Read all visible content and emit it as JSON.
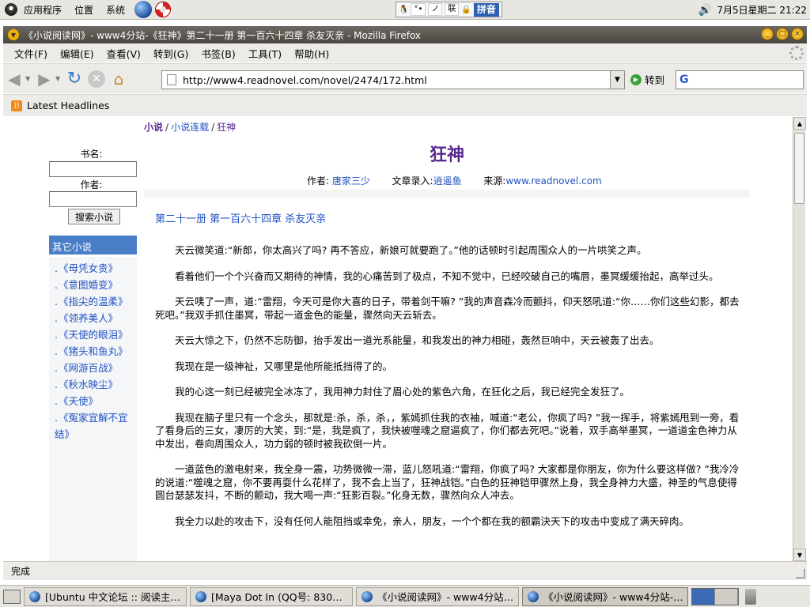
{
  "top_panel": {
    "applications": "应用程序",
    "places": "位置",
    "system": "系统",
    "ime_label": "拼音",
    "ime_seg1": "°•",
    "ime_seg2": "ノ",
    "ime_seg3": "联",
    "datetime": "7月5日星期二 21:22"
  },
  "window": {
    "title": "《小说阅读网》- www4分站-《狂神》第二十一册 第一百六十四章 杀友灭亲 - Mozilla Firefox"
  },
  "menubar": [
    "文件(F)",
    "编辑(E)",
    "查看(V)",
    "转到(G)",
    "书签(B)",
    "工具(T)",
    "帮助(H)"
  ],
  "navbar": {
    "url": "http://www4.readnovel.com/novel/2474/172.html",
    "go_label": "转到",
    "search_placeholder": ""
  },
  "bookmarks": {
    "latest_headlines": "Latest Headlines"
  },
  "breadcrumb": {
    "item1": "小说",
    "item2": "小说连载",
    "item3": "狂神"
  },
  "sidebar": {
    "book_name_label": "书名:",
    "author_label": "作者:",
    "search_button": "搜索小说",
    "other_header": "其它小说",
    "other_items": [
      "《母凭女贵》",
      "《意图婚变》",
      "《指尖的温柔》",
      "《领养美人》",
      "《天使的眼泪》",
      "《猪头和鱼丸》",
      "《网游百战》",
      "《秋水映尘》",
      "《天使》",
      "《冤家宜解不宜结》"
    ]
  },
  "main": {
    "novel_title": "狂神",
    "author_label": "作者:",
    "author": "唐家三少",
    "entry_label": "文章录入:",
    "entry_by": "逍遥鱼",
    "source_label": "来源:",
    "source": "www.readnovel.com",
    "chapter_title": "第二十一册 第一百六十四章 杀友灭亲",
    "paragraphs": [
      "天云微笑道:“新郎，你太高兴了吗? 再不答应，新娘可就要跑了。”他的话顿时引起周围众人的一片哄笑之声。",
      "看着他们一个个兴奋而又期待的神情，我的心痛苦到了极点，不知不觉中，已经咬破自己的嘴唇，墨冥缓缓抬起，高举过头。",
      "天云咦了一声，道:“雷翔，今天可是你大喜的日子，带着剑干嘛? ”我的声音森冷而颤抖，仰天怒吼道:“你……你们这些幻影，都去死吧。”我双手抓住墨冥，带起一道金色的能量，骤然向天云斩去。",
      "天云大惊之下，仍然不忘防御，抬手发出一道光系能量，和我发出的神力相碰，轰然巨响中，天云被轰了出去。",
      "我现在是一级神祉，又哪里是他所能抵挡得了的。",
      "我的心这一刻已经被完全冰冻了，我用神力封住了眉心处的紫色六角，在狂化之后，我已经完全发狂了。",
      "我现在脑子里只有一个念头，那就是:杀，杀，杀，，紫嫣抓住我的衣袖，喊道:“老公，你疯了吗? ”我一挥手，将紫嫣甩到一旁，看了看身后的三女，凄厉的大笑，到:“是，我是疯了，我快被噬魂之窟逼疯了，你们都去死吧。”说着，双手高举墨冥，一道道金色神力从中发出，卷向周围众人，功力弱的顿时被我砍倒一片。",
      "一道蓝色的激电射来，我全身一震，功势微微一滞，蓝儿怒吼道:“雷翔，你疯了吗? 大家都是你朋友，你为什么要这样做? ”我冷冷的说道:“噬魂之窟，你不要再耍什么花样了，我不会上当了，狂神战铠。”白色的狂神铠甲骤然上身，我全身神力大盛，神圣的气息使得圆台瑟瑟发抖，不断的颤动，我大喝一声:“狂影百裂。”化身无数，骤然向众人冲去。",
      "我全力以赴的攻击下，没有任何人能阻挡或幸免，亲人，朋友，一个个都在我的额霸決天下的攻击中变成了满天碎肉。"
    ]
  },
  "statusbar": {
    "text": "完成"
  },
  "taskbar": {
    "tasks": [
      "[Ubuntu 中文论坛 :: 阅读主…",
      "[Maya Dot In (QQ号: 830…",
      "《小说阅读网》- www4分站…",
      "《小说阅读网》- www4分站-…"
    ]
  }
}
